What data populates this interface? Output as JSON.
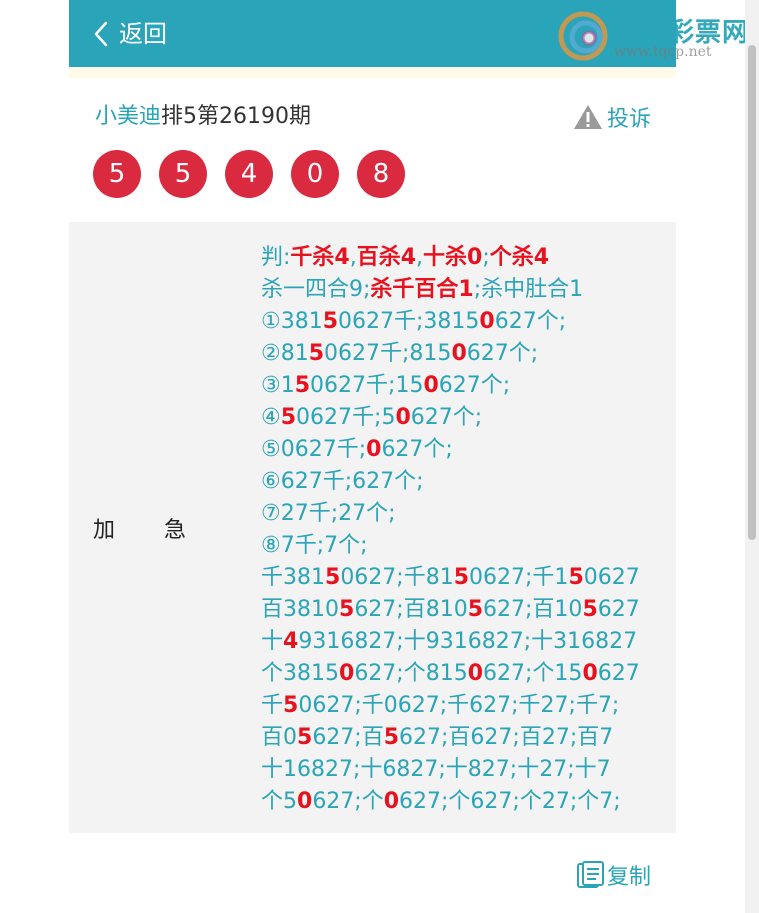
{
  "header": {
    "back_label": "返回",
    "logo": {
      "brand": "特区彩票网",
      "url": "www.tqcp.net"
    }
  },
  "title": {
    "author": "小美迪",
    "issue": "排5第26190期"
  },
  "complain_label": "投诉",
  "balls": [
    "5",
    "5",
    "4",
    "0",
    "8"
  ],
  "category": {
    "char1": "加",
    "char2": "急"
  },
  "prediction_lines": [
    [
      {
        "t": "判:"
      },
      {
        "t": "千杀4",
        "h": true
      },
      {
        "t": ","
      },
      {
        "t": "百杀4",
        "h": true
      },
      {
        "t": ","
      },
      {
        "t": "十杀0",
        "h": true
      },
      {
        "t": ";"
      },
      {
        "t": "个杀4",
        "h": true
      }
    ],
    [
      {
        "t": "杀一四合9;"
      },
      {
        "t": "杀千百合1",
        "h": true
      },
      {
        "t": ";杀中肚合1"
      }
    ],
    [
      {
        "t": "①381"
      },
      {
        "t": "5",
        "h": true
      },
      {
        "t": "0627千;3815"
      },
      {
        "t": "0",
        "h": true
      },
      {
        "t": "627个;"
      }
    ],
    [
      {
        "t": "②81"
      },
      {
        "t": "5",
        "h": true
      },
      {
        "t": "0627千;815"
      },
      {
        "t": "0",
        "h": true
      },
      {
        "t": "627个;"
      }
    ],
    [
      {
        "t": "③1"
      },
      {
        "t": "5",
        "h": true
      },
      {
        "t": "0627千;15"
      },
      {
        "t": "0",
        "h": true
      },
      {
        "t": "627个;"
      }
    ],
    [
      {
        "t": "④"
      },
      {
        "t": "5",
        "h": true
      },
      {
        "t": "0627千;5"
      },
      {
        "t": "0",
        "h": true
      },
      {
        "t": "627个;"
      }
    ],
    [
      {
        "t": "⑤0627千;"
      },
      {
        "t": "0",
        "h": true
      },
      {
        "t": "627个;"
      }
    ],
    [
      {
        "t": "⑥627千;627个;"
      }
    ],
    [
      {
        "t": "⑦27千;27个;"
      }
    ],
    [
      {
        "t": "⑧7千;7个;"
      }
    ],
    [
      {
        "t": "千381"
      },
      {
        "t": "5",
        "h": true
      },
      {
        "t": "0627;千81"
      },
      {
        "t": "5",
        "h": true
      },
      {
        "t": "0627;千1"
      },
      {
        "t": "5",
        "h": true
      },
      {
        "t": "0627"
      }
    ],
    [
      {
        "t": "百3810"
      },
      {
        "t": "5",
        "h": true
      },
      {
        "t": "627;百810"
      },
      {
        "t": "5",
        "h": true
      },
      {
        "t": "627;百10"
      },
      {
        "t": "5",
        "h": true
      },
      {
        "t": "627"
      }
    ],
    [
      {
        "t": "十"
      },
      {
        "t": "4",
        "h": true
      },
      {
        "t": "9316827;十9316827;十316827"
      }
    ],
    [
      {
        "t": "个3815"
      },
      {
        "t": "0",
        "h": true
      },
      {
        "t": "627;个815"
      },
      {
        "t": "0",
        "h": true
      },
      {
        "t": "627;个15"
      },
      {
        "t": "0",
        "h": true
      },
      {
        "t": "627"
      }
    ],
    [
      {
        "t": "千"
      },
      {
        "t": "5",
        "h": true
      },
      {
        "t": "0627;千0627;千627;千27;千7;"
      }
    ],
    [
      {
        "t": "百0"
      },
      {
        "t": "5",
        "h": true
      },
      {
        "t": "627;百"
      },
      {
        "t": "5",
        "h": true
      },
      {
        "t": "627;百627;百27;百7"
      }
    ],
    [
      {
        "t": "十16827;十6827;十827;十27;十7"
      }
    ],
    [
      {
        "t": "个5"
      },
      {
        "t": "0",
        "h": true
      },
      {
        "t": "627;个"
      },
      {
        "t": "0",
        "h": true
      },
      {
        "t": "627;个627;个27;个7;"
      }
    ]
  ],
  "copy_label": "复制",
  "colors": {
    "accent": "#2aa4b8",
    "ball": "#d92a3f",
    "highlight": "#e8121f"
  }
}
